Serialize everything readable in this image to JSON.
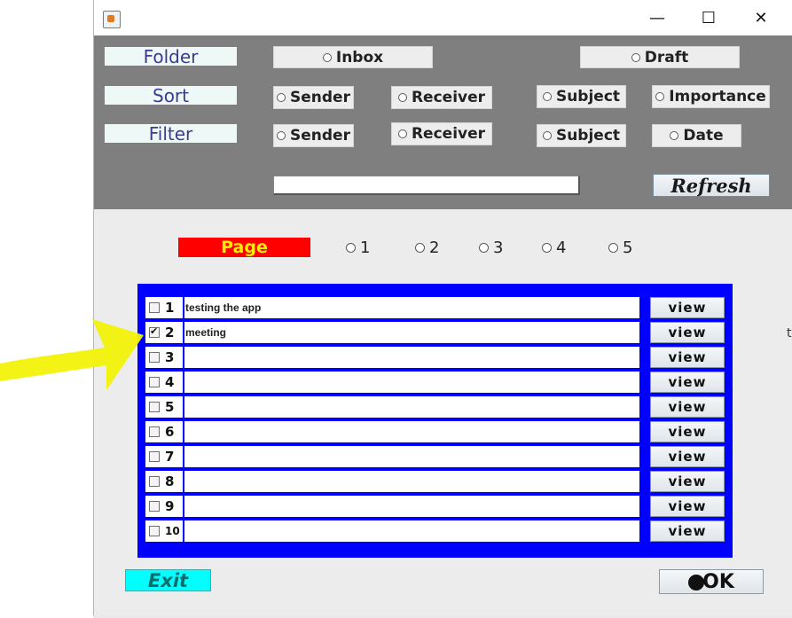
{
  "window": {
    "title": "",
    "controls": {
      "minimize": "—",
      "maximize": "☐",
      "close": "✕"
    }
  },
  "filters": {
    "folder": {
      "label": "Folder",
      "options": [
        "Inbox",
        "Draft"
      ]
    },
    "sort": {
      "label": "Sort",
      "options": [
        "Sender",
        "Receiver",
        "Subject",
        "Importance"
      ]
    },
    "filter": {
      "label": "Filter",
      "options": [
        "Sender",
        "Receiver",
        "Subject",
        "Date"
      ]
    },
    "search_value": "",
    "refresh_label": "Refresh"
  },
  "pagination": {
    "label": "Page",
    "pages": [
      "1",
      "2",
      "3",
      "4",
      "5"
    ]
  },
  "mails": [
    {
      "num": "1",
      "subject": "testing the app",
      "checked": false
    },
    {
      "num": "2",
      "subject": "meeting",
      "checked": true
    },
    {
      "num": "3",
      "subject": "",
      "checked": false
    },
    {
      "num": "4",
      "subject": "",
      "checked": false
    },
    {
      "num": "5",
      "subject": "",
      "checked": false
    },
    {
      "num": "6",
      "subject": "",
      "checked": false
    },
    {
      "num": "7",
      "subject": "",
      "checked": false
    },
    {
      "num": "8",
      "subject": "",
      "checked": false
    },
    {
      "num": "9",
      "subject": "",
      "checked": false
    },
    {
      "num": "10",
      "subject": "",
      "checked": false
    }
  ],
  "view_label": "view",
  "footer": {
    "exit_label": "Exit",
    "ok_label": "OK"
  },
  "colors": {
    "top_panel": "#7f7f7f",
    "table_border": "#0000ff",
    "page_label_bg": "#ff0000",
    "page_label_text": "#ffee00",
    "exit_bg": "#00ffff",
    "annotation_arrow": "#f2f20a"
  },
  "edge_text": "t"
}
